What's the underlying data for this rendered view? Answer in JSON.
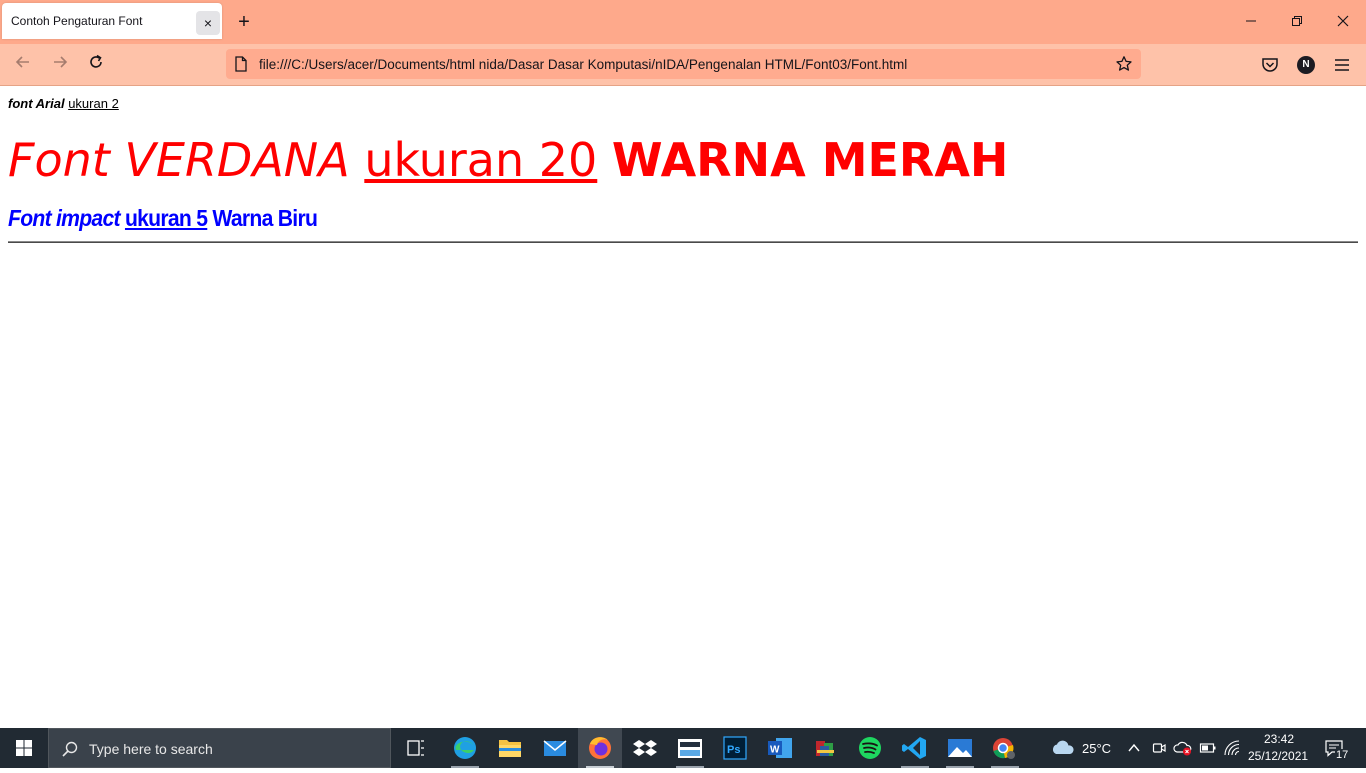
{
  "browser": {
    "tab_title": "Contoh Pengaturan Font",
    "tab_close_glyph": "×",
    "new_tab_glyph": "+",
    "url": "file:///C:/Users/acer/Documents/html nida/Dasar Dasar Komputasi/nIDA/Pengenalan HTML/Font03/Font.html",
    "profile_initial": "N",
    "colors": {
      "tabbar": "#fea98b",
      "navbar": "#fec2a9",
      "urlbar": "#ffab8f"
    }
  },
  "page": {
    "line1": {
      "part1": "font Arial",
      "part2": "ukuran 2"
    },
    "line2": {
      "part1": "Font VERDANA",
      "part2": "ukuran 20",
      "part3": "WARNA MERAH",
      "color": "#ff0000"
    },
    "line3": {
      "part1": "Font impact",
      "part2": "ukuran 5",
      "part3": "Warna Biru",
      "color": "#0000ff"
    }
  },
  "taskbar": {
    "search_placeholder": "Type here to search",
    "apps": [
      "task-view",
      "edge",
      "file-explorer",
      "mail",
      "firefox",
      "dropbox",
      "amazon",
      "photoshop",
      "word",
      "winrar",
      "spotify",
      "vscode",
      "photos",
      "chrome"
    ],
    "weather": "25°C",
    "time": "23:42",
    "date": "25/12/2021",
    "notification_count": "17"
  }
}
